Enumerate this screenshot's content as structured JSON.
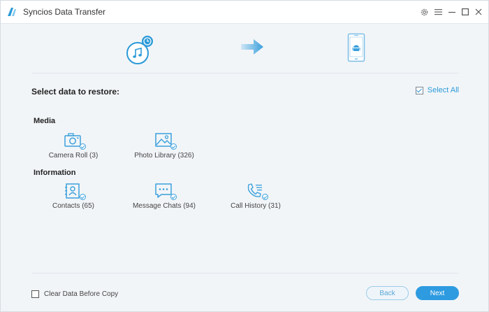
{
  "window": {
    "title": "Syncios Data Transfer",
    "controls": [
      "gear-icon",
      "menu-icon",
      "minimize-icon",
      "maximize-icon",
      "close-icon"
    ]
  },
  "header": {
    "source_icon": "music-backup-icon",
    "arrow_icon": "arrow-right-icon",
    "target_icon": "android-phone-icon"
  },
  "main": {
    "heading": "Select data to restore:",
    "select_all_label": "Select All",
    "select_all_checked": true,
    "groups": [
      {
        "label": "Media",
        "items": [
          {
            "label": "Camera Roll (3)",
            "icon": "camera-icon"
          },
          {
            "label": "Photo Library (326)",
            "icon": "photo-icon"
          }
        ]
      },
      {
        "label": "Information",
        "items": [
          {
            "label": "Contacts (65)",
            "icon": "contacts-icon"
          },
          {
            "label": "Message Chats (94)",
            "icon": "message-icon"
          },
          {
            "label": "Call History (31)",
            "icon": "phone-call-icon"
          }
        ]
      }
    ]
  },
  "footer": {
    "clear_label": "Clear Data Before Copy",
    "clear_checked": false,
    "back_label": "Back",
    "next_label": "Next"
  },
  "colors": {
    "accent": "#2e9be0",
    "icon_blue": "#3aa0dc",
    "background": "#f2f5f8"
  }
}
